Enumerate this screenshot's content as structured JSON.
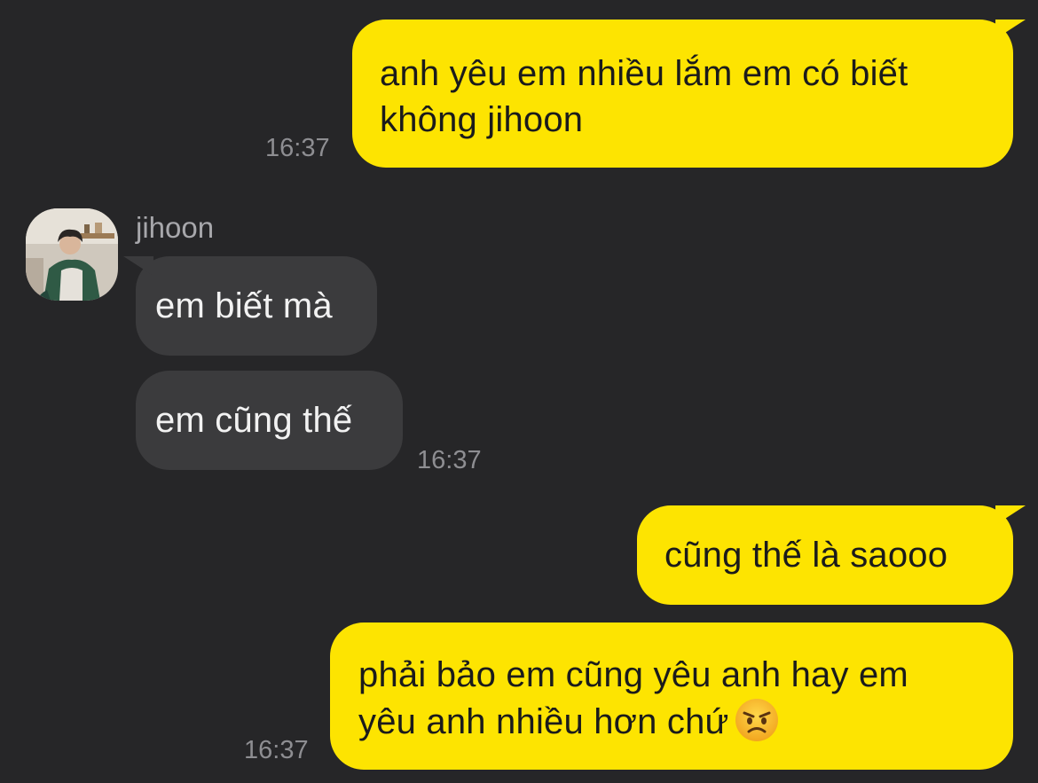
{
  "conversation": {
    "sender_name": "jihoon",
    "messages": [
      {
        "direction": "outgoing",
        "text": "anh yêu em nhiều lắm em có biết\nkhông jihoon",
        "time": "16:37"
      },
      {
        "direction": "incoming",
        "text": "em biết mà"
      },
      {
        "direction": "incoming",
        "text": "em cũng thế",
        "time": "16:37"
      },
      {
        "direction": "outgoing",
        "text": "cũng thế là saooo"
      },
      {
        "direction": "outgoing",
        "text": "phải bảo em cũng yêu anh hay em\nyêu anh nhiều hơn chứ",
        "emoji": "angry-face-emoji",
        "time": "16:37"
      }
    ]
  },
  "icons": {
    "avatar": "profile-photo-avatar",
    "emoji": "angry-face-emoji"
  },
  "colors": {
    "background": "#262628",
    "outgoing_bubble": "#fde401",
    "incoming_bubble": "#3b3b3d",
    "timestamp": "#8e8e92"
  }
}
